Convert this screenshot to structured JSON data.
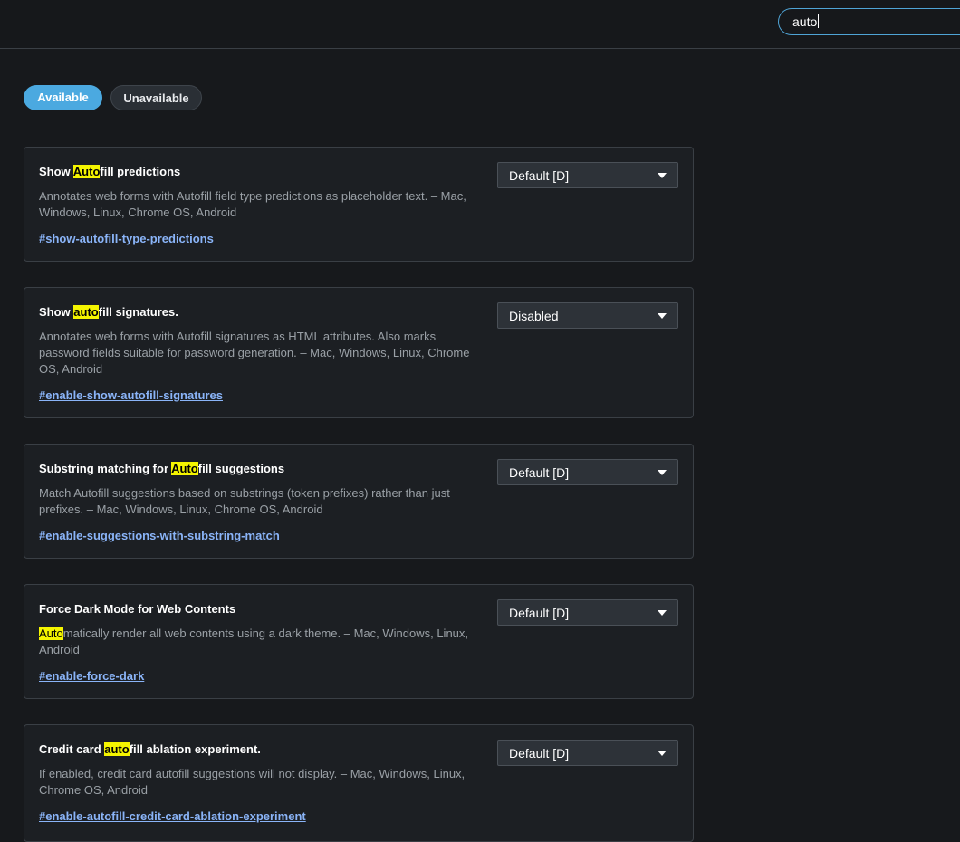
{
  "search": {
    "value": "auto"
  },
  "tabs": [
    {
      "label": "Available"
    },
    {
      "label": "Unavailable"
    }
  ],
  "flags": [
    {
      "title_pre": "Show ",
      "title_hl": "Auto",
      "title_post": "fill predictions",
      "desc_hl": "",
      "desc": "Annotates web forms with Autofill field type predictions as placeholder text. – Mac, Windows, Linux, Chrome OS, Android",
      "link": "#show-autofill-type-predictions",
      "selected": "Default [D]"
    },
    {
      "title_pre": "Show ",
      "title_hl": "auto",
      "title_post": "fill signatures.",
      "desc_hl": "",
      "desc": "Annotates web forms with Autofill signatures as HTML attributes. Also marks password fields suitable for password generation. – Mac, Windows, Linux, Chrome OS, Android",
      "link": "#enable-show-autofill-signatures",
      "selected": "Disabled"
    },
    {
      "title_pre": "Substring matching for ",
      "title_hl": "Auto",
      "title_post": "fill suggestions",
      "desc_hl": "",
      "desc": "Match Autofill suggestions based on substrings (token prefixes) rather than just prefixes. – Mac, Windows, Linux, Chrome OS, Android",
      "link": "#enable-suggestions-with-substring-match",
      "selected": "Default [D]"
    },
    {
      "title_pre": "Force Dark Mode for Web Contents",
      "title_hl": "",
      "title_post": "",
      "desc_hl": "Auto",
      "desc": "matically render all web contents using a dark theme. – Mac, Windows, Linux, Android",
      "link": "#enable-force-dark",
      "selected": "Default [D]"
    },
    {
      "title_pre": "Credit card ",
      "title_hl": "auto",
      "title_post": "fill ablation experiment.",
      "desc_hl": "",
      "desc": "If enabled, credit card autofill suggestions will not display. – Mac, Windows, Linux, Chrome OS, Android",
      "link": "#enable-autofill-credit-card-ablation-experiment",
      "selected": "Default [D]"
    }
  ],
  "colors": {
    "background": "#17191c",
    "card": "#1c1f23",
    "accent": "#4ba9e0",
    "highlight": "#f5f500",
    "link": "#8ab4f8"
  }
}
